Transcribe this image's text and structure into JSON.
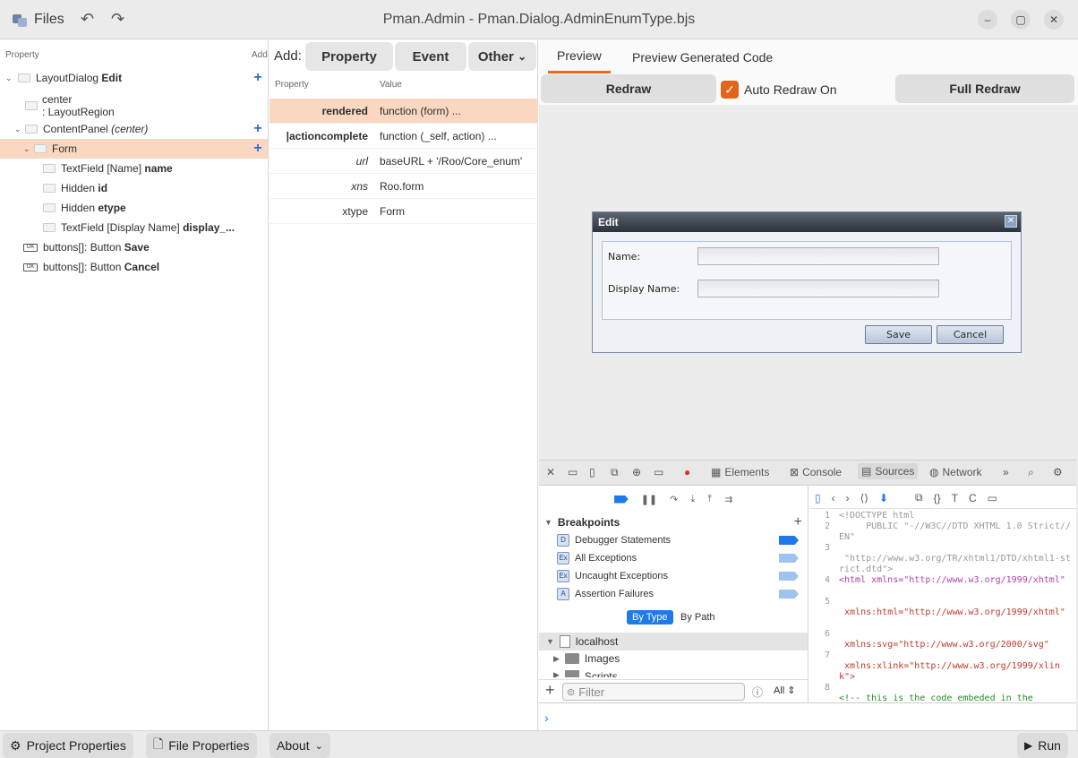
{
  "header": {
    "files_label": "Files",
    "title": "Pman.Admin - Pman.Dialog.AdminEnumType.bjs",
    "minimize_icon": "minimize-icon",
    "maximize_icon": "maximize-icon",
    "close_icon": "close-icon"
  },
  "tree": {
    "col_property": "Property",
    "col_add": "Add",
    "rows": [
      {
        "text": "LayoutDialog ",
        "bold": "Edit"
      },
      {
        "text": "center",
        "text2": ": LayoutRegion"
      },
      {
        "text": "ContentPanel ",
        "italic": "(center)"
      },
      {
        "text": "Form"
      },
      {
        "text": "TextField [Name] ",
        "bold": "name"
      },
      {
        "text": "Hidden ",
        "bold": "id"
      },
      {
        "text": "Hidden ",
        "bold": "etype"
      },
      {
        "text": "TextField [Display Name] ",
        "bold": "display_..."
      },
      {
        "text": "buttons[]: Button ",
        "bold": "Save"
      },
      {
        "text": "buttons[]: Button ",
        "bold": "Cancel"
      }
    ]
  },
  "props": {
    "add_label": "Add:",
    "btn_property": "Property",
    "btn_event": "Event",
    "btn_other": "Other",
    "col_property": "Property",
    "col_value": "Value",
    "rows": [
      {
        "key": "rendered",
        "value": "function (form) ..."
      },
      {
        "key": "|actioncomplete",
        "value": "function (_self, action) ..."
      },
      {
        "key": "url",
        "value": "baseURL + '/Roo/Core_enum'"
      },
      {
        "key": "xns",
        "value": "Roo.form"
      },
      {
        "key": "xtype",
        "value": "Form"
      }
    ]
  },
  "preview": {
    "tab_preview": "Preview",
    "tab_code": "Preview Generated Code",
    "redraw": "Redraw",
    "auto_redraw": "Auto Redraw On",
    "full_redraw": "Full Redraw",
    "dialog": {
      "title": "Edit",
      "name_label": "Name:",
      "display_label": "Display Name:",
      "save": "Save",
      "cancel": "Cancel"
    }
  },
  "devtools": {
    "tabs": {
      "elements": "Elements",
      "console": "Console",
      "sources": "Sources",
      "network": "Network"
    },
    "breakpoints_title": "Breakpoints",
    "breakpoints": [
      {
        "icon": "D",
        "label": "Debugger Statements"
      },
      {
        "icon": "Ex",
        "label": "All Exceptions"
      },
      {
        "icon": "Ex",
        "label": "Uncaught Exceptions"
      },
      {
        "icon": "A",
        "label": "Assertion Failures"
      }
    ],
    "by_type": "By Type",
    "by_path": "By Path",
    "host": "localhost",
    "images": "Images",
    "scripts": "Scripts",
    "filter_placeholder": "Filter",
    "filter_all": "All",
    "code_lines": [
      {
        "n": "1",
        "t": "<!DOCTYPE html"
      },
      {
        "n": "",
        "t": "     PUBLIC \"-//W3C//DTD XHTML 1.0 Strict//EN\""
      },
      {
        "n": "3",
        "t": ""
      },
      {
        "n": "",
        "t": " \"http://www.w3.org/TR/xhtml1/DTD/xhtml1-strict.dtd\">"
      },
      {
        "n": "4",
        "t": "<html xmlns=\"http://www.w3.org/1999/xhtml\""
      },
      {
        "n": "5",
        "t": ""
      },
      {
        "n": "",
        "t": " xmlns:html=\"http://www.w3.org/1999/xhtml\""
      },
      {
        "n": "6",
        "t": ""
      },
      {
        "n": "",
        "t": " xmlns:svg=\"http://www.w3.org/2000/svg\""
      },
      {
        "n": "7",
        "t": ""
      },
      {
        "n": "",
        "t": " xmlns:xlink=\"http://www.w3.org/1999/xlink\">"
      },
      {
        "n": "8",
        "t": ""
      },
      {
        "n": "",
        "t": "<!-- this is the code embeded in the"
      }
    ]
  },
  "bottom": {
    "project_properties": "Project Properties",
    "file_properties": "File Properties",
    "about": "About",
    "run": "Run"
  }
}
